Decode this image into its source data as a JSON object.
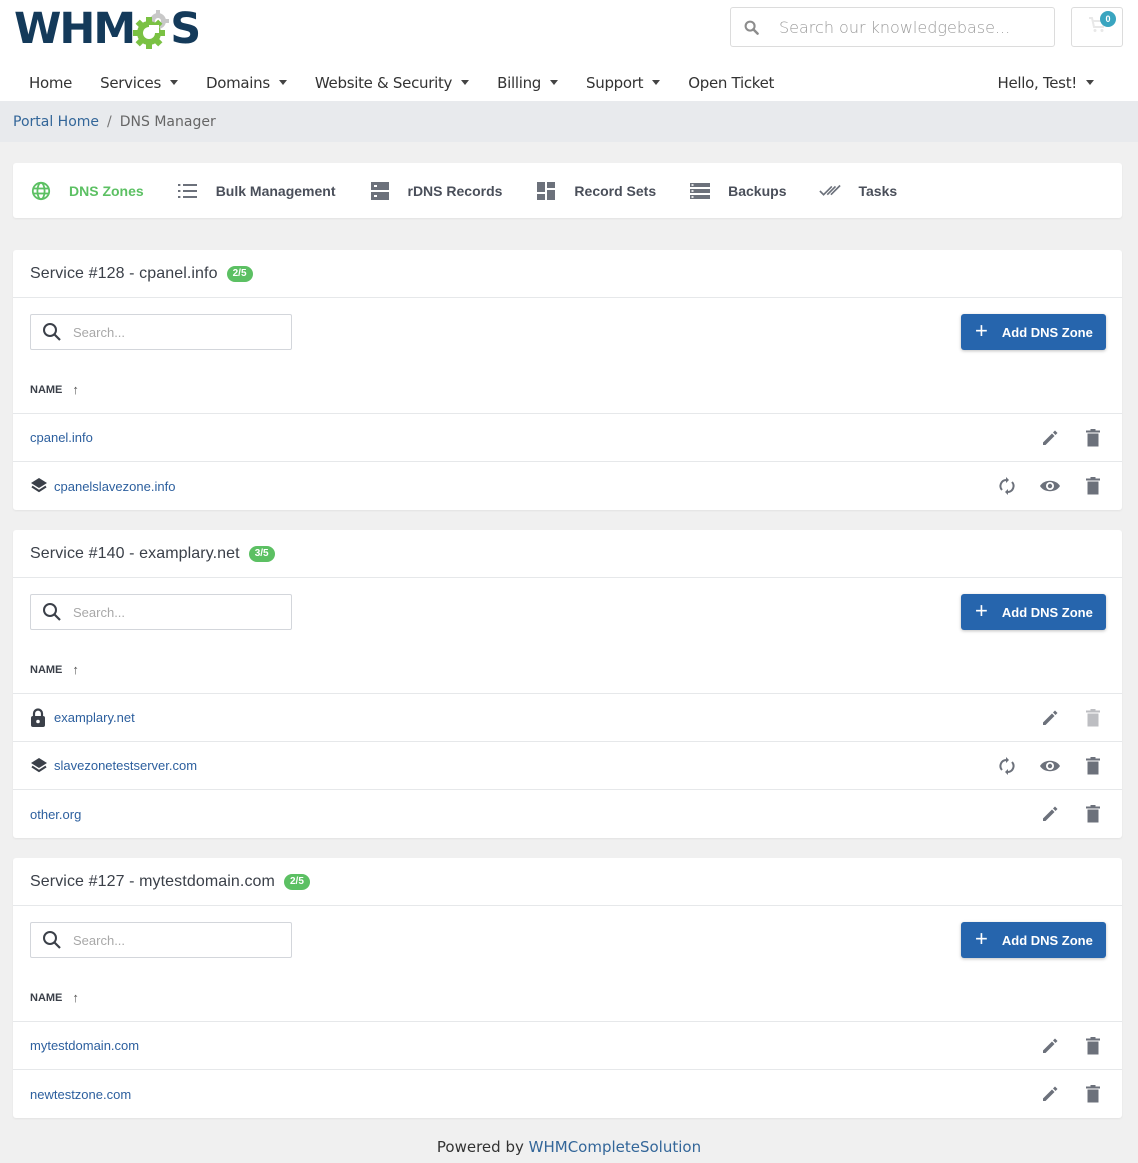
{
  "brand": {
    "logo_text_left": "WHM",
    "logo_text_right": "S",
    "accent": "#5cc063",
    "primary": "#2665ad",
    "link": "#2c5f9e"
  },
  "header": {
    "search_placeholder": "Search our knowledgebase...",
    "cart_count": "0"
  },
  "nav": {
    "items": [
      {
        "label": "Home",
        "dropdown": false
      },
      {
        "label": "Services",
        "dropdown": true
      },
      {
        "label": "Domains",
        "dropdown": true
      },
      {
        "label": "Website & Security",
        "dropdown": true
      },
      {
        "label": "Billing",
        "dropdown": true
      },
      {
        "label": "Support",
        "dropdown": true
      },
      {
        "label": "Open Ticket",
        "dropdown": false
      }
    ],
    "user_label": "Hello, Test!"
  },
  "breadcrumb": {
    "home": "Portal Home",
    "separator": "/",
    "current": "DNS Manager"
  },
  "tabs": [
    {
      "label": "DNS Zones",
      "icon": "globe-icon",
      "active": true
    },
    {
      "label": "Bulk Management",
      "icon": "list-icon",
      "active": false
    },
    {
      "label": "rDNS Records",
      "icon": "server-icon",
      "active": false
    },
    {
      "label": "Record Sets",
      "icon": "dashboard-icon",
      "active": false
    },
    {
      "label": "Backups",
      "icon": "storage-icon",
      "active": false
    },
    {
      "label": "Tasks",
      "icon": "double-check-icon",
      "active": false
    }
  ],
  "common": {
    "search_placeholder": "Search...",
    "add_button": "Add DNS Zone",
    "column_name": "NAME",
    "sort_arrow": "↑"
  },
  "services": [
    {
      "title": "Service #128 - cpanel.info",
      "badge": "2/5",
      "zones": [
        {
          "name": "cpanel.info",
          "type": "normal",
          "actions": [
            "edit",
            "delete"
          ]
        },
        {
          "name": "cpanelslavezone.info",
          "type": "slave",
          "actions": [
            "sync",
            "view",
            "delete"
          ]
        }
      ]
    },
    {
      "title": "Service #140 - examplary.net",
      "badge": "3/5",
      "zones": [
        {
          "name": "examplary.net",
          "type": "locked",
          "actions": [
            "edit",
            "delete-disabled"
          ]
        },
        {
          "name": "slavezonetestserver.com",
          "type": "slave",
          "actions": [
            "sync",
            "view",
            "delete"
          ]
        },
        {
          "name": "other.org",
          "type": "normal",
          "actions": [
            "edit",
            "delete"
          ]
        }
      ]
    },
    {
      "title": "Service #127 - mytestdomain.com",
      "badge": "2/5",
      "zones": [
        {
          "name": "mytestdomain.com",
          "type": "normal",
          "actions": [
            "edit",
            "delete"
          ]
        },
        {
          "name": "newtestzone.com",
          "type": "normal",
          "actions": [
            "edit",
            "delete"
          ]
        }
      ]
    }
  ],
  "footer": {
    "prefix": "Powered by",
    "link": "WHMCompleteSolution"
  }
}
